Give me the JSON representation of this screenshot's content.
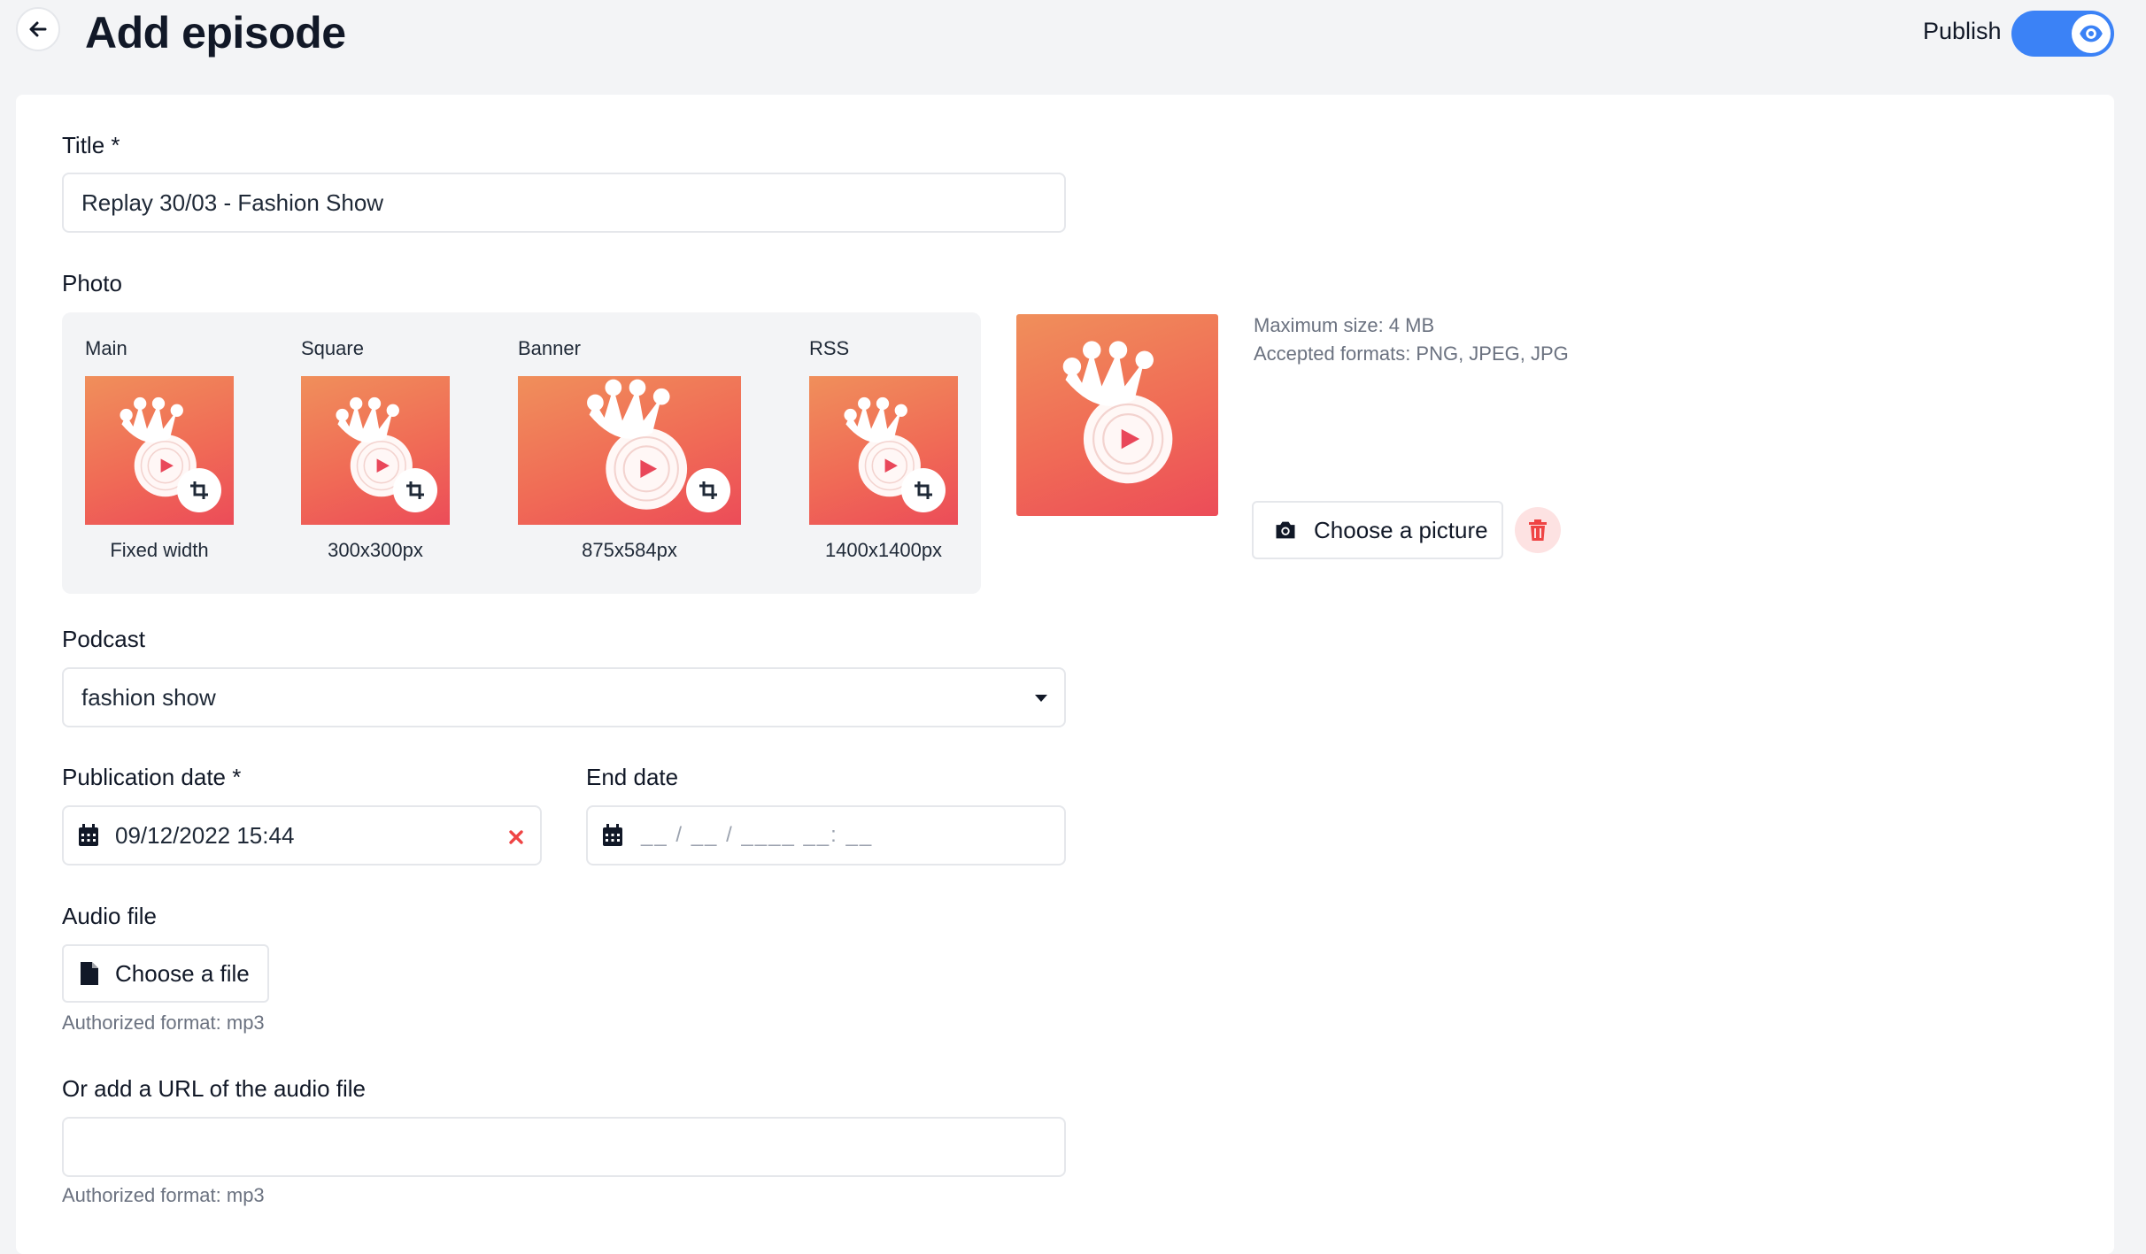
{
  "header": {
    "title": "Add episode",
    "publish_label": "Publish",
    "publish_enabled": true
  },
  "form": {
    "title_label": "Title *",
    "title_value": "Replay 30/03 - Fashion Show",
    "photo_label": "Photo",
    "photo_variants": [
      {
        "name": "Main",
        "size": "Fixed width"
      },
      {
        "name": "Square",
        "size": "300x300px"
      },
      {
        "name": "Banner",
        "size": "875x584px"
      },
      {
        "name": "RSS",
        "size": "1400x1400px"
      }
    ],
    "photo_info_size": "Maximum size: 4 MB",
    "photo_info_formats": "Accepted formats: PNG, JPEG, JPG",
    "choose_picture_label": "Choose a picture",
    "podcast_label": "Podcast",
    "podcast_value": "fashion show",
    "publication_date_label": "Publication date *",
    "publication_date_value": "09/12/2022 15:44",
    "end_date_label": "End date",
    "end_date_placeholder": "__ / __ / ____ __: __",
    "audio_file_label": "Audio file",
    "choose_file_label": "Choose a file",
    "audio_format_hint": "Authorized format: mp3",
    "audio_url_label": "Or add a URL of the audio file",
    "audio_url_value": "",
    "audio_url_hint": "Authorized format: mp3"
  },
  "colors": {
    "accent": "#3b82f6",
    "danger": "#ef4444",
    "gradient_start": "#f08f5b",
    "gradient_end": "#ec4c58"
  },
  "icons": {
    "back": "arrow-left-icon",
    "eye": "eye-icon",
    "crop": "crop-icon",
    "camera": "camera-icon",
    "trash": "trash-icon",
    "calendar": "calendar-icon",
    "clear": "close-icon",
    "file": "file-icon",
    "dropdown": "caret-down-icon"
  }
}
